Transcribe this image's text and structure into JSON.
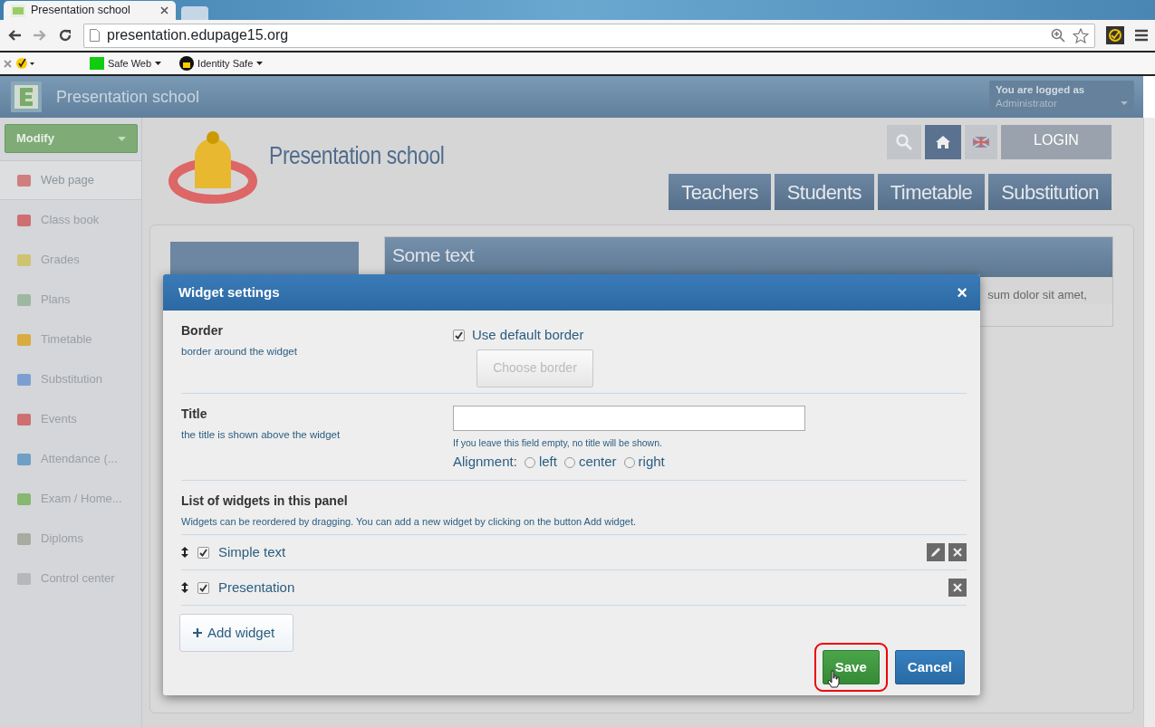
{
  "browser": {
    "tab_title": "Presentation school",
    "url": "presentation.edupage15.org",
    "toolbar_items": [
      {
        "label": "Safe Web"
      },
      {
        "label": "Identity Safe"
      }
    ]
  },
  "app_bar": {
    "title": "Presentation school",
    "user_label": "You are logged as",
    "user_name": "Administrator"
  },
  "sidebar": {
    "menu_button": "Modify",
    "items": [
      {
        "label": "Web page",
        "selected": true
      },
      {
        "label": "Class book",
        "selected": false
      },
      {
        "label": "Grades",
        "selected": false
      },
      {
        "label": "Plans",
        "selected": false
      },
      {
        "label": "Timetable",
        "selected": false
      },
      {
        "label": "Substitution",
        "selected": false
      },
      {
        "label": "Events",
        "selected": false
      },
      {
        "label": "Attendance (...",
        "selected": false
      },
      {
        "label": "Exam / Home...",
        "selected": false
      },
      {
        "label": "Diploms",
        "selected": false
      },
      {
        "label": "Control center",
        "selected": false
      }
    ]
  },
  "site": {
    "title": "Presentation school",
    "login": "LOGIN",
    "nav": [
      "Teachers",
      "Students",
      "Timetable",
      "Substitution"
    ],
    "panel_title": "Some text",
    "panel_text": "sum dolor sit amet,"
  },
  "dialog": {
    "title": "Widget settings",
    "close": "×",
    "border": {
      "label": "Border",
      "hint": "border around the widget",
      "checkbox_label": "Use default border",
      "checked": true,
      "button": "Choose border",
      "button_disabled": true
    },
    "title_field": {
      "label": "Title",
      "hint": "the title is shown above the widget",
      "note": "If you leave this field empty, no title will be shown.",
      "alignment_label": "Alignment:",
      "alignment_options": [
        {
          "label": "left",
          "selected": false
        },
        {
          "label": "center",
          "selected": false
        },
        {
          "label": "right",
          "selected": false
        }
      ]
    },
    "widgets": {
      "label": "List of widgets in this panel",
      "hint": "Widgets can be reordered by dragging. You can add a new widget by clicking on the button Add widget.",
      "items": [
        {
          "name": "Simple text",
          "checked": true,
          "editable": true
        },
        {
          "name": "Presentation",
          "checked": true,
          "editable": false
        }
      ],
      "add_button": "Add widget"
    },
    "buttons": [
      {
        "label": "Save",
        "kind": "save",
        "highlighted": true
      },
      {
        "label": "Cancel",
        "kind": "cancel",
        "highlighted": false
      }
    ]
  }
}
